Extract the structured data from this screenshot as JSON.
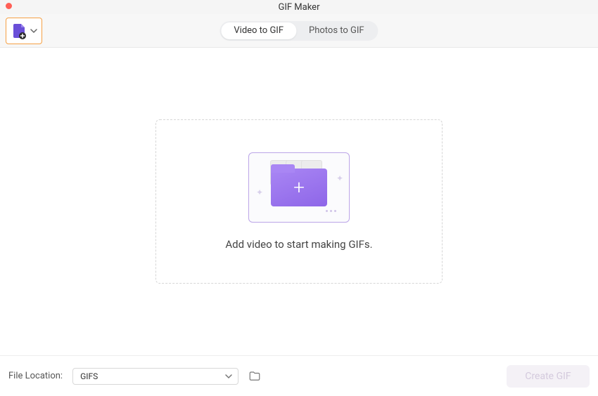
{
  "window": {
    "title": "GIF Maker"
  },
  "tabs": {
    "video": "Video to GIF",
    "photos": "Photos to GIF",
    "active": "video"
  },
  "dropzone": {
    "prompt": "Add video to start making GIFs."
  },
  "footer": {
    "label": "File Location:",
    "selected": "GIFS",
    "create_label": "Create GIF"
  }
}
